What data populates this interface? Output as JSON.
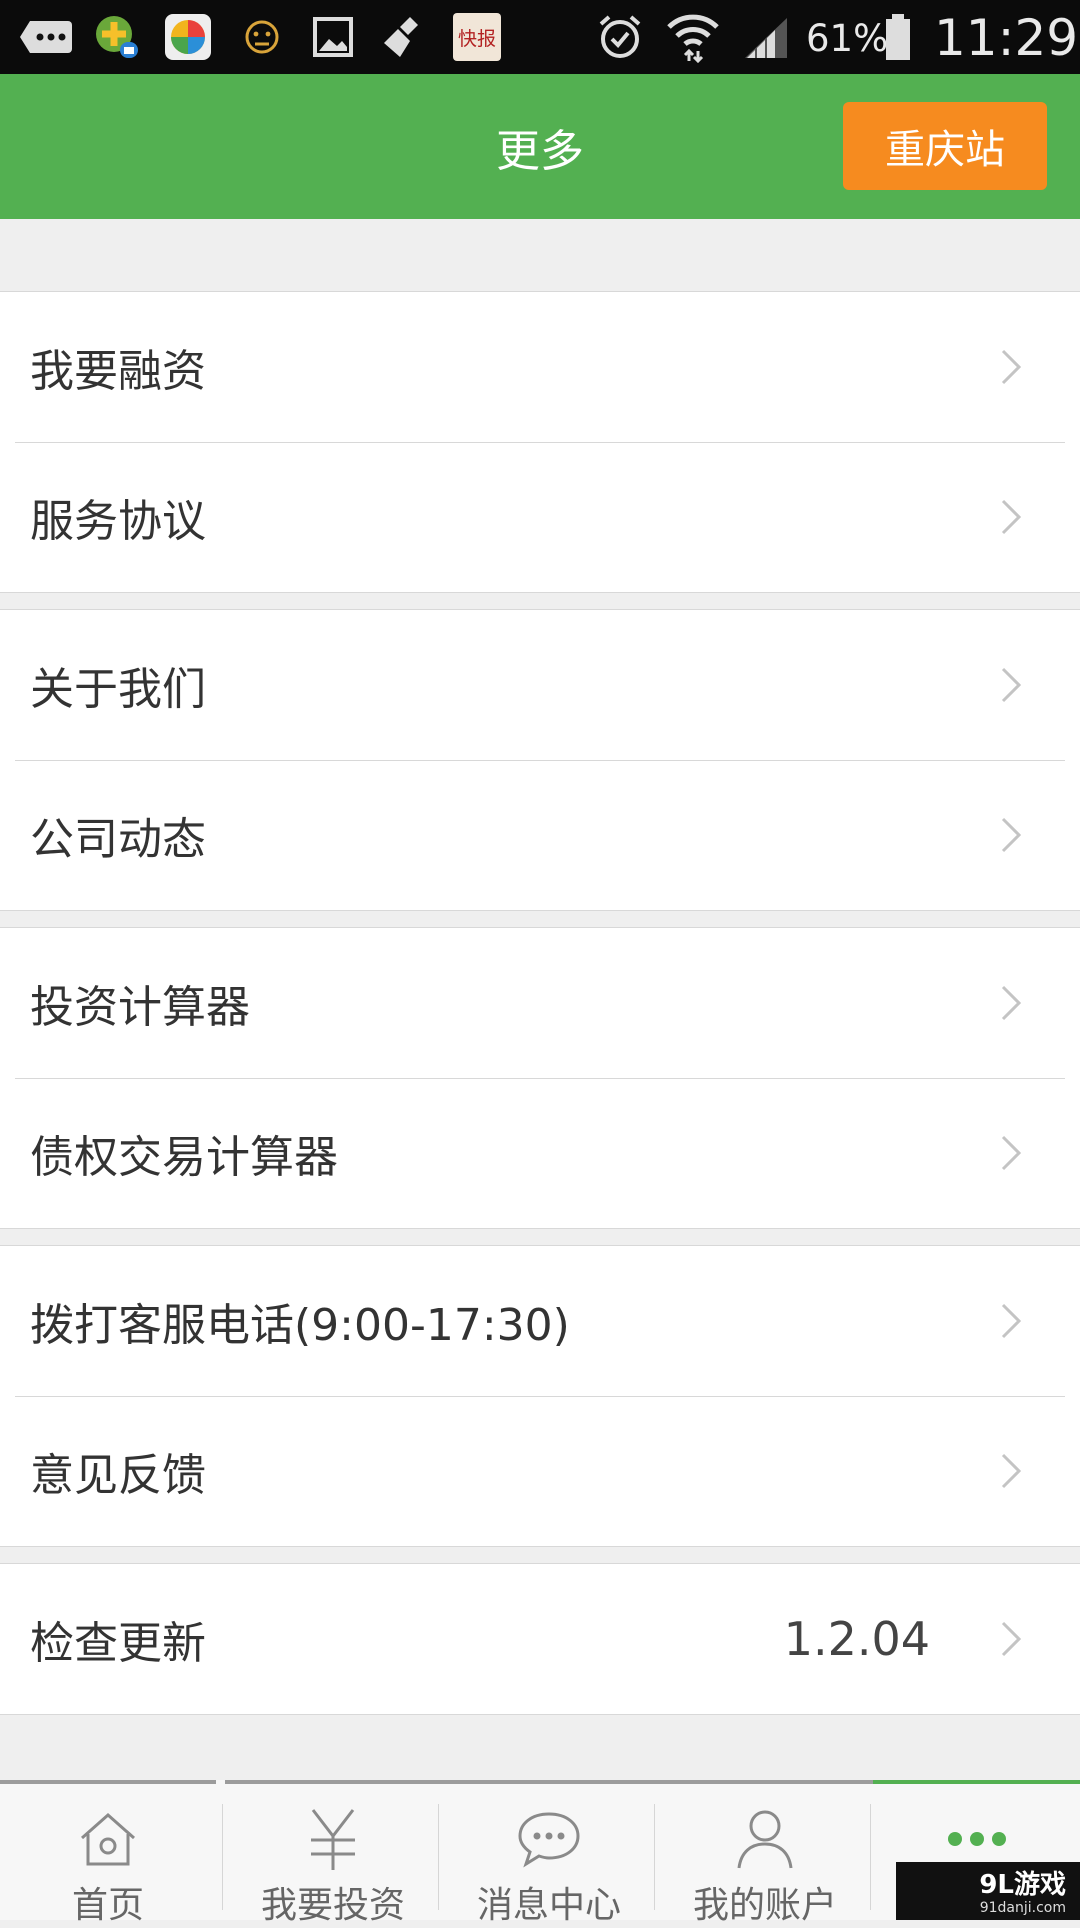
{
  "status_bar": {
    "notification_icons": [
      "more-notifications-icon",
      "app-360-icon",
      "colorful-app-icon",
      "face-icon",
      "gallery-icon",
      "broom-icon",
      "kuaibao-icon"
    ],
    "kuaibao_label": "快报",
    "battery": "61%",
    "time": "11:29"
  },
  "header": {
    "title": "更多",
    "station_button": "重庆站",
    "background": "#53b051",
    "button_color": "#f68b1f"
  },
  "groups": [
    {
      "items": [
        {
          "label": "我要融资"
        },
        {
          "label": "服务协议"
        }
      ]
    },
    {
      "items": [
        {
          "label": "关于我们"
        },
        {
          "label": "公司动态"
        }
      ]
    },
    {
      "items": [
        {
          "label": "投资计算器"
        },
        {
          "label": "债权交易计算器"
        }
      ]
    },
    {
      "items": [
        {
          "label": "拨打客服电话(9:00-17:30)"
        },
        {
          "label": "意见反馈"
        }
      ]
    },
    {
      "items": [
        {
          "label": "检查更新",
          "value": "1.2.04"
        }
      ]
    }
  ],
  "tabbar": {
    "tabs": [
      {
        "label": "首页",
        "icon": "home-icon"
      },
      {
        "label": "我要投资",
        "icon": "yen-icon"
      },
      {
        "label": "消息中心",
        "icon": "chat-icon"
      },
      {
        "label": "我的账户",
        "icon": "user-icon"
      },
      {
        "label": "",
        "icon": "more-dots-icon",
        "active": true
      }
    ]
  },
  "watermark": {
    "brand": "9L游戏",
    "site": "91danji.com"
  }
}
